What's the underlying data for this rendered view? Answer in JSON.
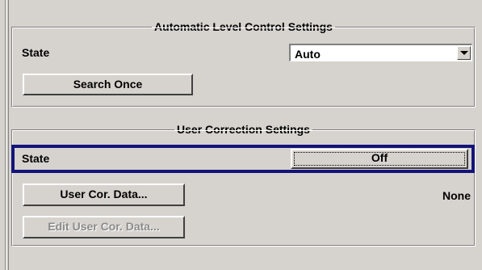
{
  "alc": {
    "title": "Automatic Level Control Settings",
    "state_label": "State",
    "state_value": "Auto",
    "search_once_label": "Search Once"
  },
  "ucor": {
    "title": "User Correction Settings",
    "state_label": "State",
    "state_button": "Off",
    "user_cor_data_label": "User Cor. Data...",
    "user_cor_data_value": "None",
    "edit_user_cor_data_label": "Edit User Cor. Data..."
  }
}
